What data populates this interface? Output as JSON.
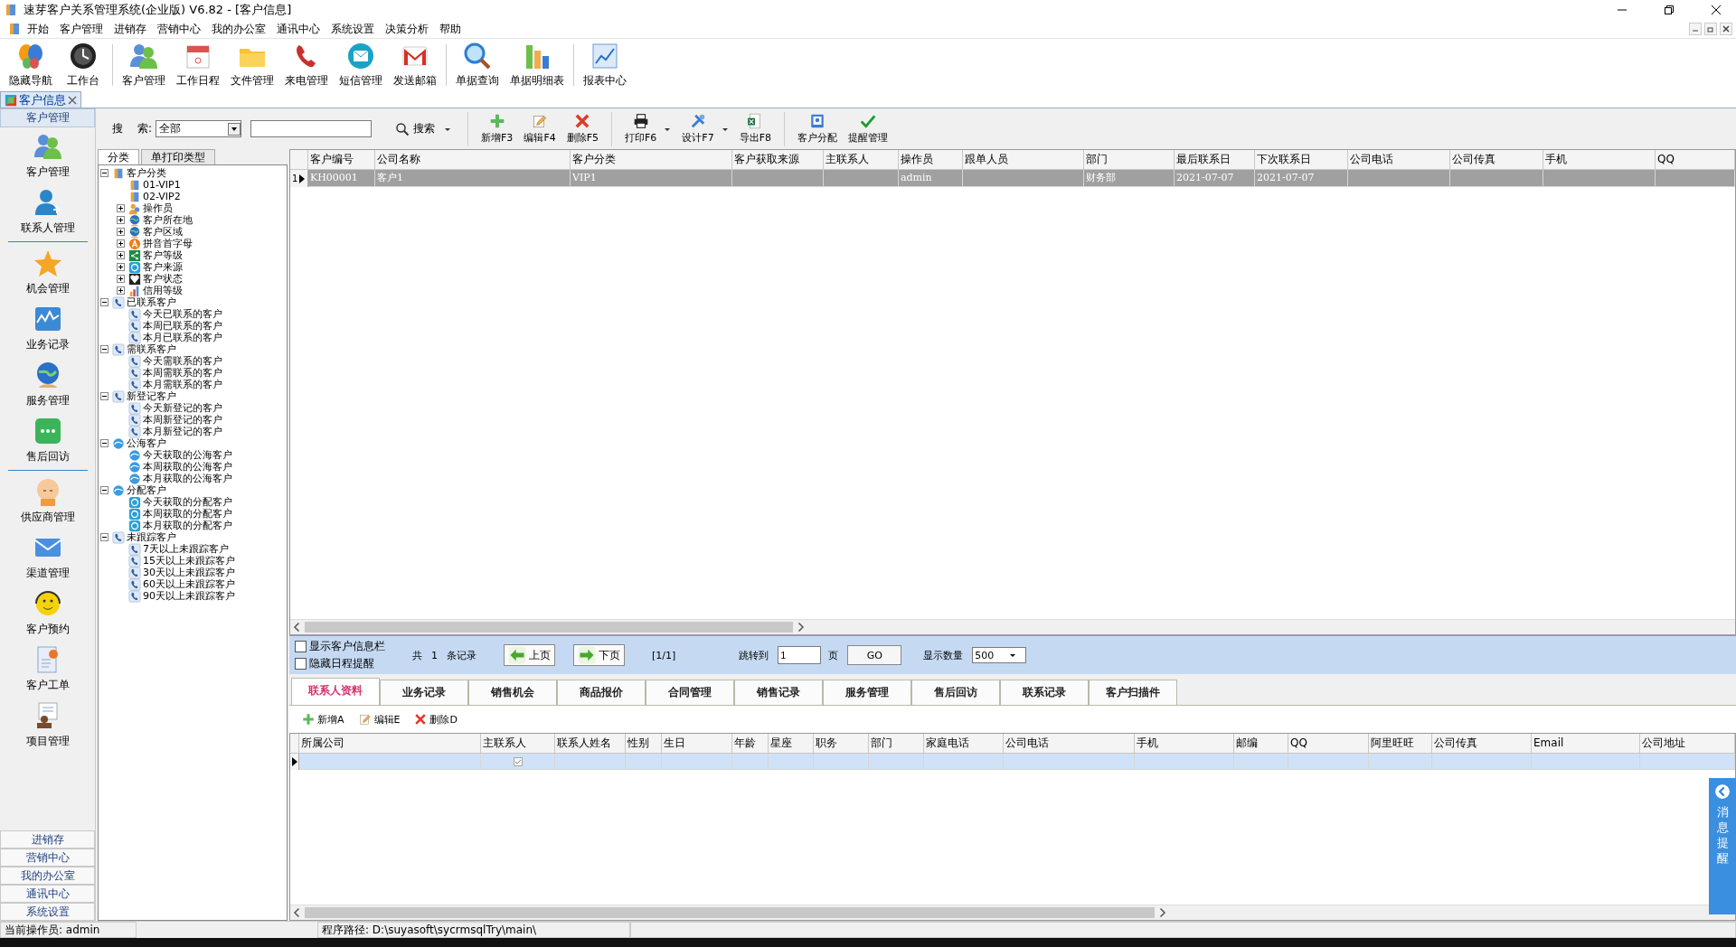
{
  "window": {
    "title": "速芽客户关系管理系统(企业版) V6.82 - [客户信息]"
  },
  "menu": [
    "开始",
    "客户管理",
    "进销存",
    "营销中心",
    "我的办公室",
    "通讯中心",
    "系统设置",
    "决策分析",
    "帮助"
  ],
  "toolbar": [
    [
      {
        "label": "隐藏导航"
      },
      {
        "label": "工作台"
      }
    ],
    [
      {
        "label": "客户管理"
      },
      {
        "label": "工作日程"
      },
      {
        "label": "文件管理"
      },
      {
        "label": "来电管理"
      },
      {
        "label": "短信管理"
      },
      {
        "label": "发送邮箱"
      }
    ],
    [
      {
        "label": "单据查询"
      },
      {
        "label": "单据明细表"
      }
    ],
    [
      {
        "label": "报表中心"
      }
    ]
  ],
  "doc_tabs": [
    {
      "label": "客户信息",
      "selected": true
    }
  ],
  "sidebar": {
    "header": "客户管理",
    "groups": [
      [
        {
          "label": "客户管理"
        },
        {
          "label": "联系人管理"
        }
      ],
      [
        {
          "label": "机会管理"
        },
        {
          "label": "业务记录"
        },
        {
          "label": "服务管理"
        },
        {
          "label": "售后回访"
        }
      ],
      [
        {
          "label": "供应商管理"
        },
        {
          "label": "渠道管理"
        },
        {
          "label": "客户预约"
        },
        {
          "label": "客户工单"
        },
        {
          "label": "项目管理"
        }
      ]
    ],
    "sections": [
      "进销存",
      "营销中心",
      "我的办公室",
      "通讯中心",
      "系统设置"
    ]
  },
  "search": {
    "label_1": "搜",
    "label_2": "索:",
    "scope": "全部",
    "button": "搜索"
  },
  "actions": [
    [
      {
        "label": "新增F3",
        "has_menu": false
      },
      {
        "label": "编辑F4",
        "has_menu": false
      },
      {
        "label": "删除F5",
        "has_menu": false
      }
    ],
    [
      {
        "label": "打印F6",
        "has_menu": true
      },
      {
        "label": "设计F7",
        "has_menu": true
      },
      {
        "label": "导出F8",
        "has_menu": false
      }
    ],
    [
      {
        "label": "客户分配",
        "has_menu": false
      },
      {
        "label": "提醒管理",
        "has_menu": false
      }
    ]
  ],
  "tree_tabs": [
    {
      "label": "分类",
      "selected": true
    },
    {
      "label": "单打印类型",
      "selected": false
    }
  ],
  "tree": [
    {
      "label": "客户分类",
      "kind": "book",
      "expanded": true,
      "children": [
        {
          "label": "01-VIP1",
          "kind": "book"
        },
        {
          "label": "02-VIP2",
          "kind": "book"
        },
        {
          "label": "操作员",
          "kind": "person",
          "expanded": false
        },
        {
          "label": "客户所在地",
          "kind": "globe",
          "expanded": false
        },
        {
          "label": "客户区域",
          "kind": "globe",
          "expanded": false
        },
        {
          "label": "拼音首字母",
          "kind": "letter",
          "expanded": false
        },
        {
          "label": "客户等级",
          "kind": "share",
          "expanded": false
        },
        {
          "label": "客户来源",
          "kind": "badge",
          "expanded": false
        },
        {
          "label": "客户状态",
          "kind": "heart",
          "expanded": false
        },
        {
          "label": "信用等级",
          "kind": "chart",
          "expanded": false
        }
      ]
    },
    {
      "label": "已联系客户",
      "kind": "phone",
      "expanded": true,
      "children": [
        {
          "label": "今天已联系的客户",
          "kind": "phone"
        },
        {
          "label": "本周已联系的客户",
          "kind": "phone"
        },
        {
          "label": "本月已联系的客户",
          "kind": "phone"
        }
      ]
    },
    {
      "label": "需联系客户",
      "kind": "phone",
      "expanded": true,
      "children": [
        {
          "label": "今天需联系的客户",
          "kind": "phone"
        },
        {
          "label": "本周需联系的客户",
          "kind": "phone"
        },
        {
          "label": "本月需联系的客户",
          "kind": "phone"
        }
      ]
    },
    {
      "label": "新登记客户",
      "kind": "phone",
      "expanded": true,
      "children": [
        {
          "label": "今天新登记的客户",
          "kind": "phone"
        },
        {
          "label": "本周新登记的客户",
          "kind": "phone"
        },
        {
          "label": "本月新登记的客户",
          "kind": "phone"
        }
      ]
    },
    {
      "label": "公海客户",
      "kind": "cloud",
      "expanded": true,
      "children": [
        {
          "label": "今天获取的公海客户",
          "kind": "cloud"
        },
        {
          "label": "本周获取的公海客户",
          "kind": "cloud"
        },
        {
          "label": "本月获取的公海客户",
          "kind": "cloud"
        }
      ]
    },
    {
      "label": "分配客户",
      "kind": "cloud",
      "expanded": true,
      "children": [
        {
          "label": "今天获取的分配客户",
          "kind": "badge"
        },
        {
          "label": "本周获取的分配客户",
          "kind": "badge"
        },
        {
          "label": "本月获取的分配客户",
          "kind": "badge"
        }
      ]
    },
    {
      "label": "未跟踪客户",
      "kind": "phone",
      "expanded": true,
      "children": [
        {
          "label": "7天以上未跟踪客户",
          "kind": "phone"
        },
        {
          "label": "15天以上未跟踪客户",
          "kind": "phone"
        },
        {
          "label": "30天以上未跟踪客户",
          "kind": "phone"
        },
        {
          "label": "60天以上未跟踪客户",
          "kind": "phone"
        },
        {
          "label": "90天以上未跟踪客户",
          "kind": "phone"
        }
      ]
    }
  ],
  "grid": {
    "columns": [
      "客户编号",
      "公司名称",
      "客户分类",
      "客户获取来源",
      "主联系人",
      "操作员",
      "跟单人员",
      "部门",
      "最后联系日",
      "下次联系日",
      "公司电话",
      "公司传真",
      "手机",
      "QQ"
    ],
    "rows": [
      {
        "number": "1",
        "selected": true,
        "cells": [
          "KH00001",
          "客户1",
          "VIP1",
          null,
          null,
          "admin",
          null,
          "财务部",
          "2021-07-07",
          "2021-07-07",
          null,
          null,
          null,
          null
        ]
      }
    ]
  },
  "pager": {
    "options": [
      {
        "label": "显示客户信息栏",
        "checked": false
      },
      {
        "label": "隐藏日程提醒",
        "checked": false
      }
    ],
    "total_prefix": "共",
    "total": "1",
    "total_suffix": "条记录",
    "prev": "上页",
    "next": "下页",
    "page": "[1/1]",
    "jump_label": "跳转到",
    "jump_value": "1",
    "jump_unit": "页",
    "go": "GO",
    "size_label": "显示数量",
    "size": "500"
  },
  "detail_tabs": [
    {
      "label": "联系人资料",
      "selected": true
    },
    {
      "label": "业务记录",
      "selected": false
    },
    {
      "label": "销售机会",
      "selected": false
    },
    {
      "label": "商品报价",
      "selected": false
    },
    {
      "label": "合同管理",
      "selected": false
    },
    {
      "label": "销售记录",
      "selected": false
    },
    {
      "label": "服务管理",
      "selected": false
    },
    {
      "label": "售后回访",
      "selected": false
    },
    {
      "label": "联系记录",
      "selected": false
    },
    {
      "label": "客户扫描件",
      "selected": false
    }
  ],
  "detail_actions": [
    "新增A",
    "编辑E",
    "删除D"
  ],
  "contacts": {
    "columns": [
      "所属公司",
      "主联系人",
      "联系人姓名",
      "性别",
      "生日",
      "年龄",
      "星座",
      "职务",
      "部门",
      "家庭电话",
      "公司电话",
      "手机",
      "邮编",
      "QQ",
      "阿里旺旺",
      "公司传真",
      "Email",
      "公司地址"
    ],
    "rows": [
      {
        "selected": true,
        "main_contact": true
      }
    ]
  },
  "message_tab": {
    "label": "消息提醒"
  },
  "status_bar": [
    "当前操作员: admin",
    "程序路径: D:\\suyasoft\\sycrmsqlTry\\main\\"
  ]
}
